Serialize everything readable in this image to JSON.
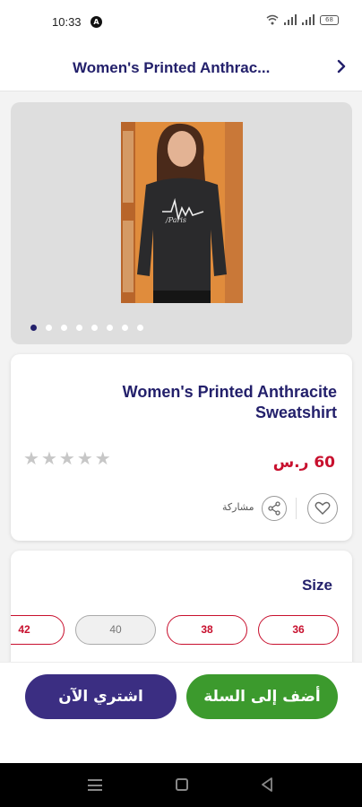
{
  "status_bar": {
    "time": "10:33",
    "a_badge": "A",
    "battery": "68"
  },
  "header": {
    "title": "Women's Printed Anthrac..."
  },
  "gallery": {
    "dot_count": 8,
    "active_index": 0,
    "image_print_text": "/Paris"
  },
  "product": {
    "name": "Women's Printed Anthracite Sweatshirt",
    "price": "60 ر.س",
    "rating": 0,
    "rating_max": 5,
    "share_label": "مشاركة"
  },
  "size_section": {
    "title": "Size",
    "options": [
      {
        "label": "36",
        "available": true
      },
      {
        "label": "38",
        "available": true
      },
      {
        "label": "40",
        "available": false
      },
      {
        "label": "42",
        "available": true
      }
    ]
  },
  "actions": {
    "add_to_cart": "أضف إلى السلة",
    "buy_now": "اشتري الآن"
  },
  "colors": {
    "brand_navy": "#23206b",
    "price_red": "#c8102e",
    "cart_green": "#3c9a2d",
    "buy_purple": "#3b2e82"
  }
}
